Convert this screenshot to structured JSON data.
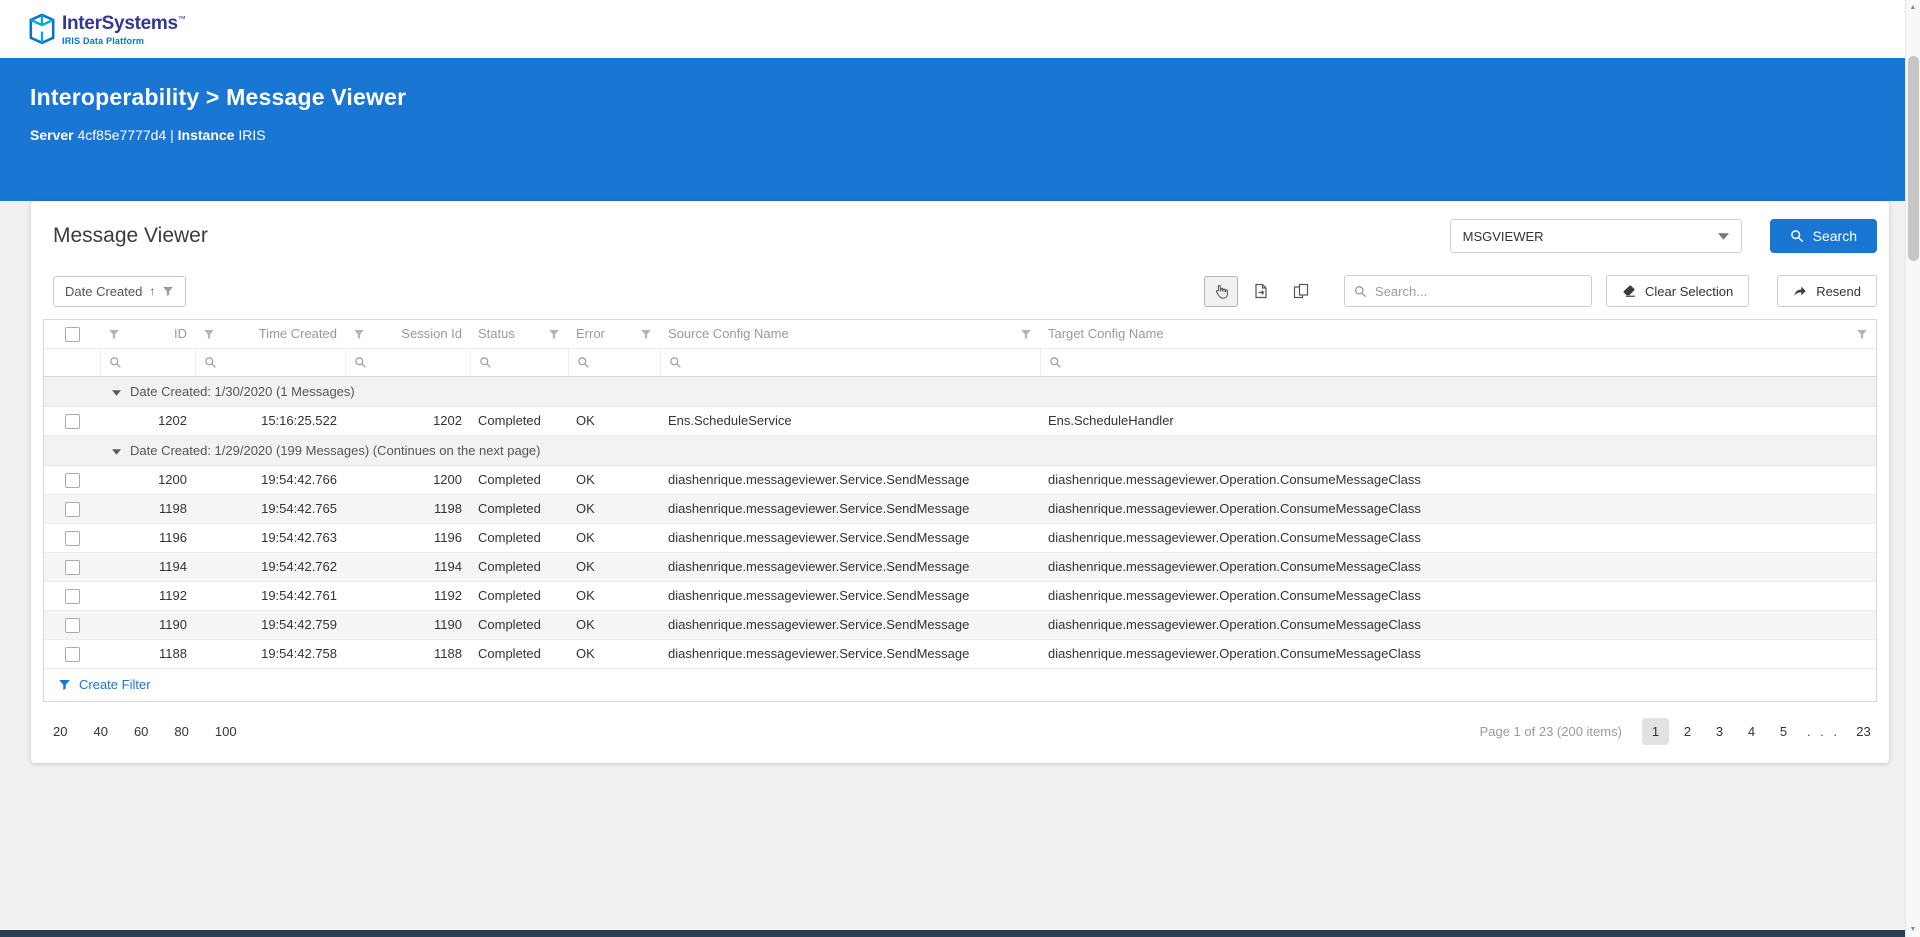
{
  "brand": {
    "name": "InterSystems",
    "trademark": "™",
    "subtitle": "IRIS Data Platform"
  },
  "hero": {
    "breadcrumb": "Interoperability > Message Viewer",
    "server_label": "Server",
    "server_value": "4cf85e7777d4",
    "divider": "|",
    "instance_label": "Instance",
    "instance_value": "IRIS"
  },
  "card": {
    "title": "Message Viewer"
  },
  "namespace": {
    "selected": "MSGVIEWER"
  },
  "search": {
    "button_label": "Search",
    "toolbar_placeholder": "Search..."
  },
  "toolbar": {
    "sort_label": "Date Created",
    "sort_direction": "↑",
    "clear_selection_label": "Clear Selection",
    "resend_label": "Resend"
  },
  "colors": {
    "accent_blue": "#1976d2",
    "brand_navy": "#333695",
    "brand_blue": "#0077c8"
  },
  "grid": {
    "columns": [
      "ID",
      "Time Created",
      "Session Id",
      "Status",
      "Error",
      "Source Config Name",
      "Target Config Name"
    ],
    "groups": [
      {
        "label": "Date Created: 1/30/2020 (1 Messages)",
        "rows": [
          {
            "id": "1202",
            "time_created": "15:16:25.522",
            "session_id": "1202",
            "status": "Completed",
            "error": "OK",
            "source": "Ens.ScheduleService",
            "target": "Ens.ScheduleHandler"
          }
        ]
      },
      {
        "label": "Date Created: 1/29/2020 (199 Messages) (Continues on the next page)",
        "rows": [
          {
            "id": "1200",
            "time_created": "19:54:42.766",
            "session_id": "1200",
            "status": "Completed",
            "error": "OK",
            "source": "diashenrique.messageviewer.Service.SendMessage",
            "target": "diashenrique.messageviewer.Operation.ConsumeMessageClass"
          },
          {
            "id": "1198",
            "time_created": "19:54:42.765",
            "session_id": "1198",
            "status": "Completed",
            "error": "OK",
            "source": "diashenrique.messageviewer.Service.SendMessage",
            "target": "diashenrique.messageviewer.Operation.ConsumeMessageClass"
          },
          {
            "id": "1196",
            "time_created": "19:54:42.763",
            "session_id": "1196",
            "status": "Completed",
            "error": "OK",
            "source": "diashenrique.messageviewer.Service.SendMessage",
            "target": "diashenrique.messageviewer.Operation.ConsumeMessageClass"
          },
          {
            "id": "1194",
            "time_created": "19:54:42.762",
            "session_id": "1194",
            "status": "Completed",
            "error": "OK",
            "source": "diashenrique.messageviewer.Service.SendMessage",
            "target": "diashenrique.messageviewer.Operation.ConsumeMessageClass"
          },
          {
            "id": "1192",
            "time_created": "19:54:42.761",
            "session_id": "1192",
            "status": "Completed",
            "error": "OK",
            "source": "diashenrique.messageviewer.Service.SendMessage",
            "target": "diashenrique.messageviewer.Operation.ConsumeMessageClass"
          },
          {
            "id": "1190",
            "time_created": "19:54:42.759",
            "session_id": "1190",
            "status": "Completed",
            "error": "OK",
            "source": "diashenrique.messageviewer.Service.SendMessage",
            "target": "diashenrique.messageviewer.Operation.ConsumeMessageClass"
          },
          {
            "id": "1188",
            "time_created": "19:54:42.758",
            "session_id": "1188",
            "status": "Completed",
            "error": "OK",
            "source": "diashenrique.messageviewer.Service.SendMessage",
            "target": "diashenrique.messageviewer.Operation.ConsumeMessageClass"
          }
        ]
      }
    ],
    "create_filter_label": "Create Filter"
  },
  "pager": {
    "page_sizes": [
      "20",
      "40",
      "60",
      "80",
      "100"
    ],
    "summary": "Page 1 of 23 (200 items)",
    "pages": [
      "1",
      "2",
      "3",
      "4",
      "5",
      "...",
      "23"
    ],
    "current_page": "1"
  }
}
